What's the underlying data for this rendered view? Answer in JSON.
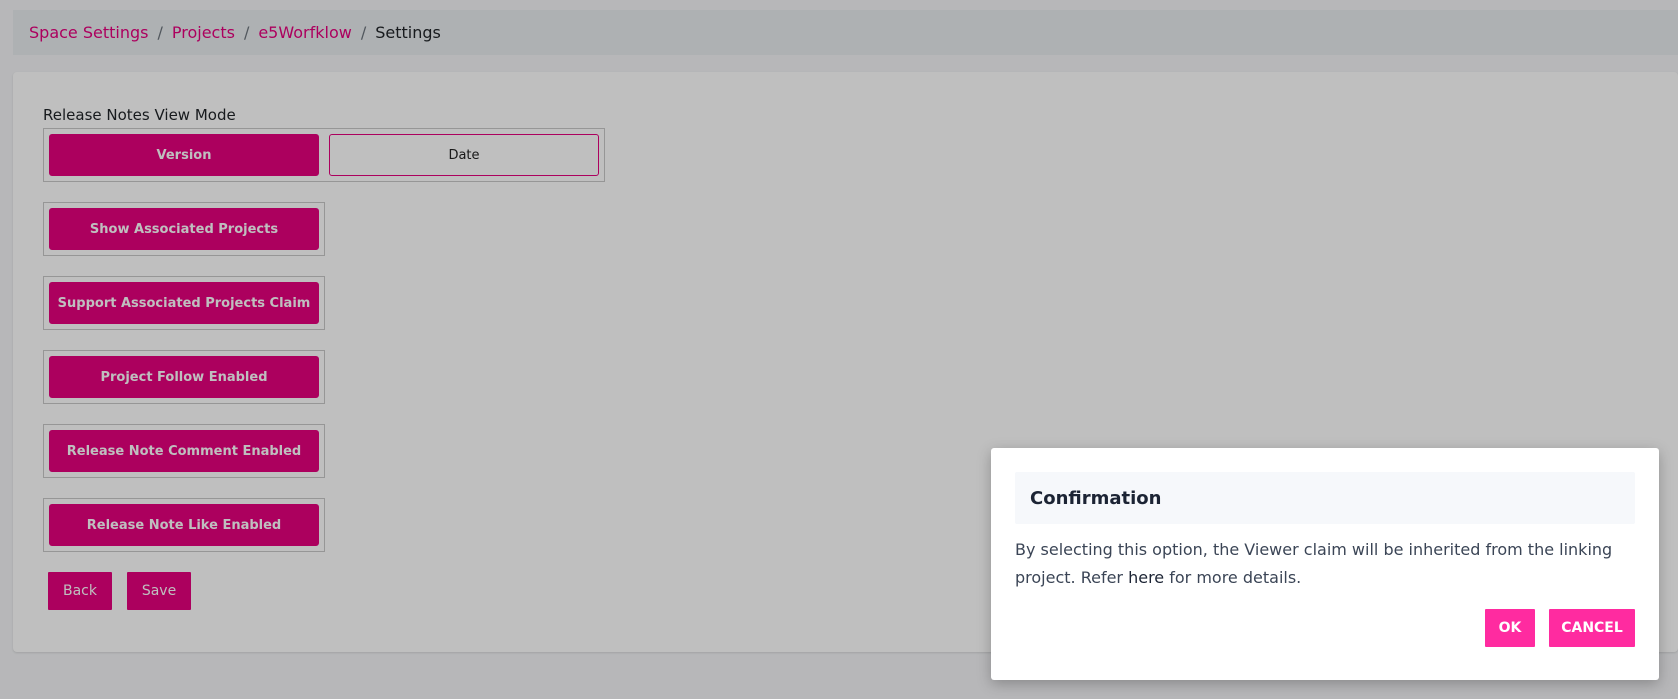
{
  "breadcrumb": {
    "items": [
      "Space Settings",
      "Projects",
      "e5Worfklow"
    ],
    "separator": "/",
    "current": "Settings"
  },
  "settings": {
    "view_mode_label": "Release Notes View Mode",
    "view_mode_options": [
      "Version",
      "Date"
    ],
    "view_mode_selected": "Version",
    "toggles": [
      "Show Associated Projects",
      "Support Associated Projects Claim",
      "Project Follow Enabled",
      "Release Note Comment Enabled",
      "Release Note Like Enabled"
    ],
    "back_label": "Back",
    "save_label": "Save"
  },
  "modal": {
    "title": "Confirmation",
    "body_before": "By selecting this option, the Viewer claim will be inherited from the linking project. Refer ",
    "body_link": "here",
    "body_after": " for more details.",
    "ok_label": "OK",
    "cancel_label": "CANCEL"
  },
  "colors": {
    "accent": "#e6007e",
    "modal_button": "#ff2ba0"
  }
}
